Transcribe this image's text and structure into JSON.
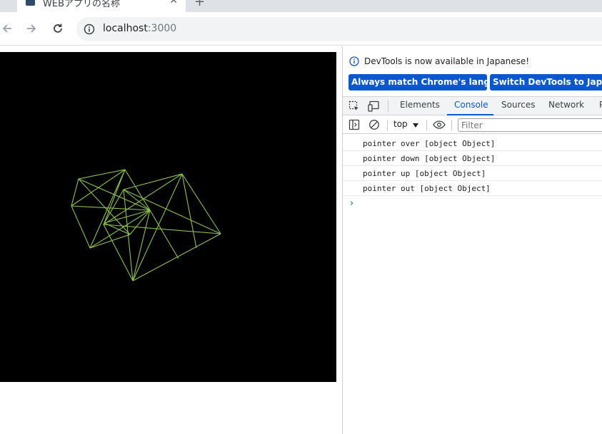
{
  "browser": {
    "tab_title": "WEBアプリの名称",
    "tab_close": "✕",
    "new_tab": "+",
    "url_host": "localhost",
    "url_port": ":3000"
  },
  "devtools": {
    "info_text": "DevTools is now available in Japanese!",
    "match_language_label": "Always match Chrome's language",
    "switch_language_label": "Switch DevTools to Japanese",
    "tabs": {
      "elements": "Elements",
      "console": "Console",
      "sources": "Sources",
      "network": "Network",
      "more": "P"
    },
    "context": "top",
    "filter_placeholder": "Filter",
    "messages": [
      "pointer over [object Object]",
      "pointer down [object Object]",
      "pointer up [object Object]",
      "pointer out [object Object]"
    ],
    "prompt": "›"
  },
  "colors": {
    "wireframe": "#8bc34a",
    "canvas_bg": "#000000",
    "accent": "#0b57d0"
  }
}
